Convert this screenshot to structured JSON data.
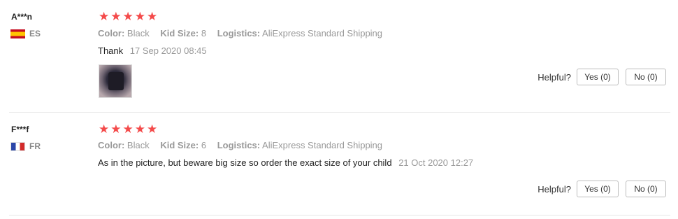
{
  "labels": {
    "color": "Color:",
    "kid_size": "Kid Size:",
    "logistics": "Logistics:",
    "helpful": "Helpful?"
  },
  "star_color": "#f44a4a",
  "reviews": [
    {
      "user": "A***n",
      "country": "ES",
      "rating": 5,
      "color": "Black",
      "kid_size": "8",
      "logistics": "AliExpress Standard Shipping",
      "text": "Thank",
      "date": "17 Sep 2020 08:45",
      "has_photo": true,
      "yes": "Yes (0)",
      "no": "No (0)"
    },
    {
      "user": "F***f",
      "country": "FR",
      "rating": 5,
      "color": "Black",
      "kid_size": "6",
      "logistics": "AliExpress Standard Shipping",
      "text": "As in the picture, but beware big size so order the exact size of your child",
      "date": "21 Oct 2020 12:27",
      "has_photo": false,
      "yes": "Yes (0)",
      "no": "No (0)"
    }
  ]
}
